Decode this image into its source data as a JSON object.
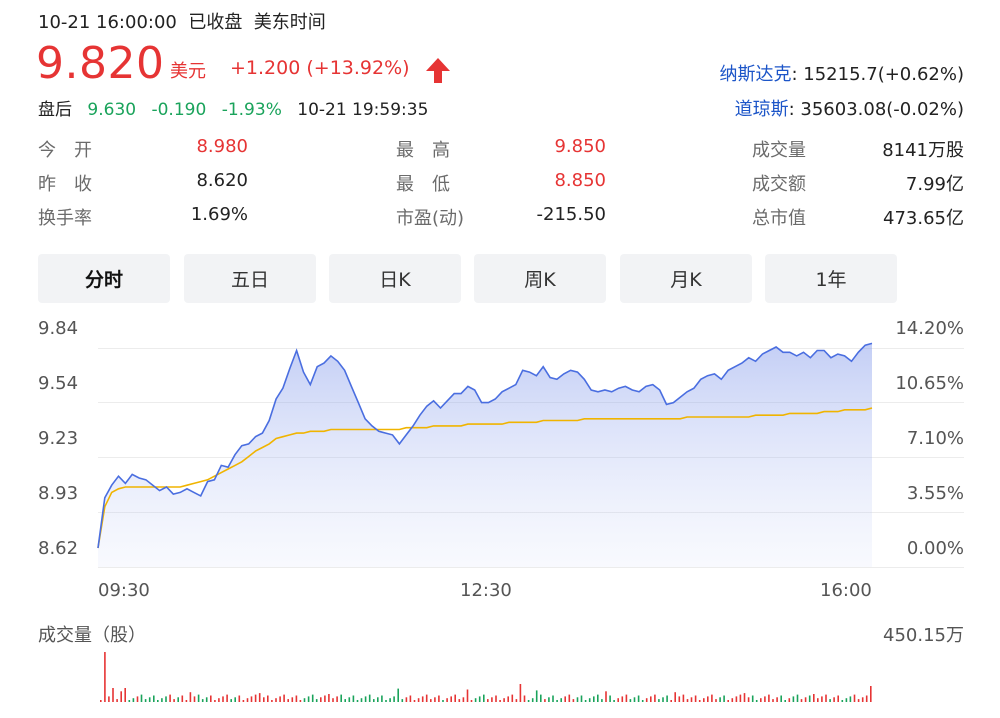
{
  "header": {
    "datetime": "10-21 16:00:00",
    "status": "已收盘",
    "timezone": "美东时间"
  },
  "quote": {
    "price": "9.820",
    "currency": "美元",
    "change": "+1.200",
    "change_pct": "(+13.92%)",
    "direction_icon": "up-arrow-icon",
    "up_color": "#e63434",
    "down_color": "#1aa35b"
  },
  "after_hours": {
    "label": "盘后",
    "price": "9.630",
    "change": "-0.190",
    "change_pct": "-1.93%",
    "time": "10-21 19:59:35"
  },
  "indices": [
    {
      "name": "纳斯达克",
      "value": ": 15215.7(+0.62%)"
    },
    {
      "name": "道琼斯",
      "value": ": 35603.08(-0.02%)"
    }
  ],
  "stats": {
    "open_label": "今　开",
    "open": "8.980",
    "prev_close_label": "昨　收",
    "prev_close": "8.620",
    "turnover_rate_label": "换手率",
    "turnover_rate": "1.69%",
    "high_label": "最　高",
    "high": "9.850",
    "low_label": "最　低",
    "low": "8.850",
    "pe_label": "市盈(动)",
    "pe": "-215.50",
    "volume_label": "成交量",
    "volume": "8141万股",
    "amount_label": "成交额",
    "amount": "7.99亿",
    "market_cap_label": "总市值",
    "market_cap": "473.65亿"
  },
  "tabs": [
    "分时",
    "五日",
    "日K",
    "周K",
    "月K",
    "1年"
  ],
  "active_tab": 0,
  "volume_section": {
    "label": "成交量（股）",
    "max_label": "450.15万"
  },
  "chart_data": {
    "type": "line",
    "y_ticks": [
      "9.84",
      "9.54",
      "9.23",
      "8.93",
      "8.62"
    ],
    "y_pct_ticks": [
      "14.20%",
      "10.65%",
      "7.10%",
      "3.55%",
      "0.00%"
    ],
    "x_ticks": [
      "09:30",
      "12:30",
      "16:00"
    ],
    "ylim": [
      8.62,
      9.84
    ],
    "series": [
      {
        "name": "price",
        "color": "#4a6ee0",
        "values": [
          8.62,
          8.9,
          8.97,
          9.02,
          8.98,
          9.03,
          9.01,
          9.0,
          8.97,
          8.94,
          8.96,
          8.92,
          8.93,
          8.95,
          8.93,
          8.91,
          8.99,
          9.0,
          9.08,
          9.07,
          9.14,
          9.19,
          9.2,
          9.24,
          9.26,
          9.33,
          9.45,
          9.51,
          9.62,
          9.72,
          9.6,
          9.53,
          9.63,
          9.65,
          9.69,
          9.66,
          9.61,
          9.52,
          9.43,
          9.34,
          9.3,
          9.27,
          9.26,
          9.25,
          9.2,
          9.25,
          9.3,
          9.36,
          9.41,
          9.44,
          9.4,
          9.44,
          9.48,
          9.48,
          9.52,
          9.5,
          9.43,
          9.43,
          9.45,
          9.49,
          9.51,
          9.53,
          9.61,
          9.6,
          9.58,
          9.63,
          9.57,
          9.56,
          9.59,
          9.61,
          9.6,
          9.56,
          9.5,
          9.49,
          9.5,
          9.49,
          9.51,
          9.52,
          9.5,
          9.49,
          9.52,
          9.53,
          9.5,
          9.42,
          9.43,
          9.46,
          9.49,
          9.51,
          9.56,
          9.58,
          9.59,
          9.56,
          9.61,
          9.63,
          9.65,
          9.68,
          9.66,
          9.7,
          9.72,
          9.74,
          9.71,
          9.71,
          9.69,
          9.71,
          9.68,
          9.72,
          9.72,
          9.68,
          9.7,
          9.69,
          9.66,
          9.71,
          9.75,
          9.76
        ]
      },
      {
        "name": "avg",
        "color": "#f0b400",
        "values": [
          8.62,
          8.85,
          8.93,
          8.95,
          8.96,
          8.96,
          8.96,
          8.96,
          8.96,
          8.96,
          8.96,
          8.96,
          8.96,
          8.97,
          8.98,
          8.99,
          9.0,
          9.02,
          9.04,
          9.06,
          9.08,
          9.1,
          9.13,
          9.16,
          9.18,
          9.2,
          9.23,
          9.24,
          9.25,
          9.26,
          9.26,
          9.27,
          9.27,
          9.27,
          9.28,
          9.28,
          9.28,
          9.28,
          9.28,
          9.28,
          9.28,
          9.28,
          9.28,
          9.28,
          9.28,
          9.29,
          9.29,
          9.29,
          9.29,
          9.3,
          9.3,
          9.3,
          9.3,
          9.3,
          9.31,
          9.31,
          9.31,
          9.31,
          9.31,
          9.31,
          9.32,
          9.32,
          9.32,
          9.32,
          9.32,
          9.33,
          9.33,
          9.33,
          9.33,
          9.33,
          9.33,
          9.34,
          9.34,
          9.34,
          9.34,
          9.34,
          9.34,
          9.34,
          9.34,
          9.34,
          9.34,
          9.34,
          9.34,
          9.34,
          9.34,
          9.34,
          9.35,
          9.35,
          9.35,
          9.35,
          9.35,
          9.35,
          9.35,
          9.35,
          9.35,
          9.35,
          9.36,
          9.36,
          9.36,
          9.36,
          9.36,
          9.37,
          9.37,
          9.37,
          9.37,
          9.37,
          9.38,
          9.38,
          9.38,
          9.39,
          9.39,
          9.39,
          9.39,
          9.4
        ]
      }
    ]
  }
}
